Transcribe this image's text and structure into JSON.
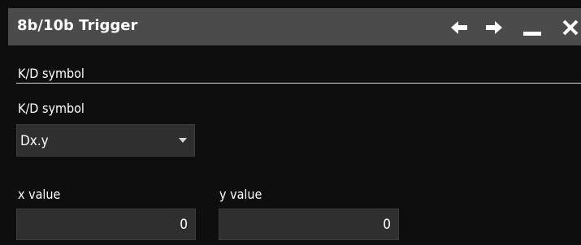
{
  "window": {
    "title": "8b/10b Trigger",
    "buttons": [
      {
        "icon": "arrow-left-icon"
      },
      {
        "icon": "arrow-right-icon"
      },
      {
        "icon": "minimize-icon"
      },
      {
        "icon": "close-icon"
      }
    ]
  },
  "section": {
    "heading": "K/D symbol"
  },
  "kd_symbol": {
    "label": "K/D symbol",
    "selected": "Dx.y"
  },
  "x_value": {
    "label": "x value",
    "value": "0"
  },
  "y_value": {
    "label": "y value",
    "value": "0"
  },
  "colors": {
    "titlebar": "#4b4b4b",
    "background": "#0e0e0e",
    "field": "#2f2f2f",
    "text": "#ffffff"
  }
}
